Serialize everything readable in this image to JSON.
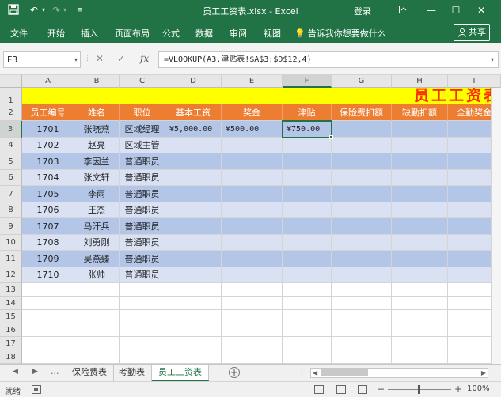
{
  "titlebar": {
    "title": "员工工资表.xlsx - Excel",
    "login": "登录"
  },
  "ribbon": {
    "tabs": [
      "文件",
      "开始",
      "插入",
      "页面布局",
      "公式",
      "数据",
      "审阅",
      "视图"
    ],
    "tell_me": "告诉我你想要做什么",
    "share": "共享"
  },
  "formula_bar": {
    "name_box": "F3",
    "fx": "fx",
    "formula": "=VLOOKUP(A3,津贴表!$A$3:$D$12,4)"
  },
  "grid": {
    "columns": [
      "A",
      "B",
      "C",
      "D",
      "E",
      "F",
      "G",
      "H",
      "I"
    ],
    "rows": [
      "1",
      "2",
      "3",
      "4",
      "5",
      "6",
      "7",
      "8",
      "9",
      "10",
      "11",
      "12",
      "13",
      "14",
      "15",
      "16",
      "17",
      "18"
    ],
    "sheet_title": "员工工资表",
    "headers": [
      "员工编号",
      "姓名",
      "职位",
      "基本工资",
      "奖金",
      "津贴",
      "保险费扣额",
      "缺勤扣额",
      "全勤奖金"
    ],
    "records": [
      [
        "1701",
        "张晓燕",
        "区域经理",
        "¥5,000.00",
        "¥500.00",
        "¥750.00"
      ],
      [
        "1702",
        "赵亮",
        "区域主管",
        "",
        "",
        ""
      ],
      [
        "1703",
        "李因兰",
        "普通职员",
        "",
        "",
        ""
      ],
      [
        "1704",
        "张文轩",
        "普通职员",
        "",
        "",
        ""
      ],
      [
        "1705",
        "李雨",
        "普通职员",
        "",
        "",
        ""
      ],
      [
        "1706",
        "王杰",
        "普通职员",
        "",
        "",
        ""
      ],
      [
        "1707",
        "马汗兵",
        "普通职员",
        "",
        "",
        ""
      ],
      [
        "1708",
        "刘勇刚",
        "普通职员",
        "",
        "",
        ""
      ],
      [
        "1709",
        "吴燕臻",
        "普通职员",
        "",
        "",
        ""
      ],
      [
        "1710",
        "张帅",
        "普通职员",
        "",
        "",
        ""
      ]
    ],
    "band_colors": [
      "#b4c6e7",
      "#d9e1f2"
    ],
    "selected_cell": "F3"
  },
  "sheet_tabs": {
    "ellipsis": "...",
    "tabs": [
      "保险费表",
      "考勤表",
      "员工工资表"
    ],
    "active_index": 2
  },
  "status": {
    "ready": "就绪",
    "zoom": "100%"
  }
}
